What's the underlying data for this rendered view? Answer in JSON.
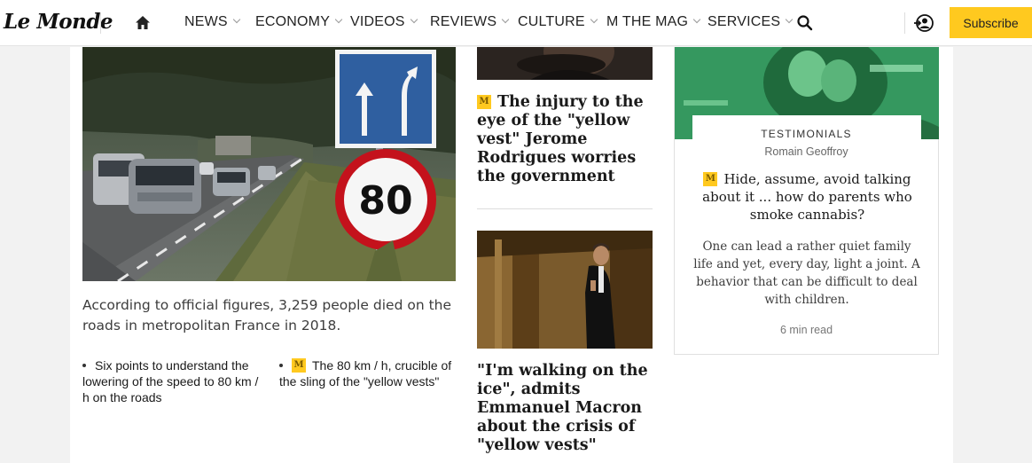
{
  "header": {
    "logo": "Le Monde",
    "nav": [
      {
        "label": "NEWS"
      },
      {
        "label": "ECONOMY"
      },
      {
        "label": "VIDEOS"
      },
      {
        "label": "REVIEWS"
      },
      {
        "label": "CULTURE"
      },
      {
        "label": "M THE MAG"
      },
      {
        "label": "SERVICES"
      }
    ],
    "subscribe_label": "Subscribe",
    "accent": "#ffc91f"
  },
  "lead": {
    "image_sign_number": "80",
    "caption": "According to official figures, 3,259 people died on the roads in metropolitan France in 2018.",
    "related": [
      {
        "label": "Six points to understand the lowering of the speed to 80 km / h on the roads"
      },
      {
        "badge": "M",
        "label": "The 80 km / h, crucible of the sling of the \"yellow vests\""
      }
    ]
  },
  "middle": {
    "article1": {
      "badge": "M",
      "title": "The injury to the eye of the \"yellow vest\" Jerome Rodrigues worries the government"
    },
    "article2": {
      "title": "\"I'm walking on the ice\", admits Emmanuel Macron about the crisis of \"yellow vests\""
    }
  },
  "card": {
    "kicker": "TESTIMONIALS",
    "author": "Romain Geoffroy",
    "badge": "M",
    "title": "Hide, assume, avoid talking about it ... how do parents who smoke cannabis?",
    "excerpt": "One can lead a rather quiet family life and yet, every day, light a joint. A behavior that can be difficult to deal with children.",
    "read_time": "6 min read"
  }
}
